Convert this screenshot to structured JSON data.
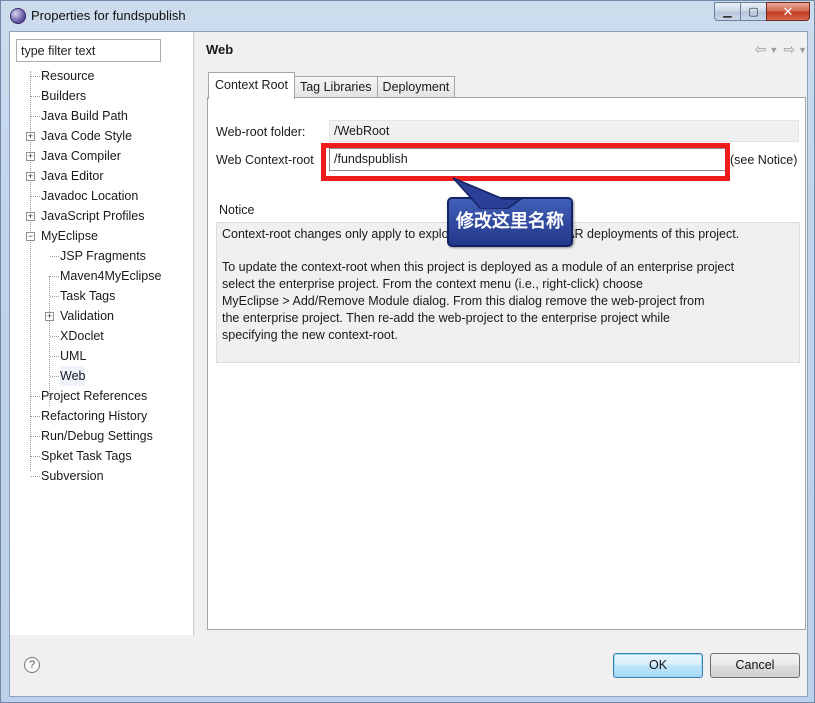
{
  "window": {
    "title": "Properties for fundspublish",
    "controls": {
      "minimize": "▁",
      "maximize": "▢",
      "close": "✕"
    }
  },
  "filter": {
    "placeholder": "type filter text"
  },
  "tree": {
    "items": [
      {
        "label": "Resource"
      },
      {
        "label": "Builders"
      },
      {
        "label": "Java Build Path"
      },
      {
        "label": "Java Code Style"
      },
      {
        "label": "Java Compiler"
      },
      {
        "label": "Java Editor"
      },
      {
        "label": "Javadoc Location"
      },
      {
        "label": "JavaScript Profiles"
      },
      {
        "label": "MyEclipse"
      },
      {
        "label": "JSP Fragments"
      },
      {
        "label": "Maven4MyEclipse"
      },
      {
        "label": "Task Tags"
      },
      {
        "label": "Validation"
      },
      {
        "label": "XDoclet"
      },
      {
        "label": "UML"
      },
      {
        "label": "Web"
      },
      {
        "label": "Project References"
      },
      {
        "label": "Refactoring History"
      },
      {
        "label": "Run/Debug Settings"
      },
      {
        "label": "Spket Task Tags"
      },
      {
        "label": "Subversion"
      }
    ]
  },
  "page": {
    "title": "Web",
    "tabs": [
      {
        "label": "Context Root"
      },
      {
        "label": "Tag Libraries"
      },
      {
        "label": "Deployment"
      }
    ],
    "web_root_label": "Web-root folder:",
    "web_root_value": "/WebRoot",
    "context_root_label": "Web Context-root",
    "context_root_value": "/fundspublish",
    "see_notice": "(see Notice)",
    "notice_label": "Notice",
    "notice_para1": "Context-root changes only apply to exploded and packaged WAR deployments of this project.",
    "notice_para2": "To update the context-root when this project is deployed as a module of an enterprise project\nselect the enterprise project. From the context menu (i.e., right-click) choose\nMyEclipse > Add/Remove Module dialog. From this dialog remove the web-project from\nthe enterprise project. Then re-add the web-project to the enterprise project while\nspecifying the new context-root."
  },
  "annotation": {
    "callout_text": "修改这里名称",
    "highlight_color": "#ee1c1c"
  },
  "buttons": {
    "help": "?",
    "ok": "OK",
    "cancel": "Cancel"
  }
}
